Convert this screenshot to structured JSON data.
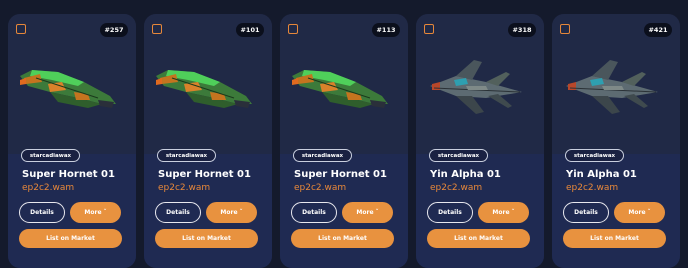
{
  "colors": {
    "accent": "#e8923f",
    "owner_text": "#e8883a",
    "card_bg": "#1c2440",
    "page_bg": "#141a2c"
  },
  "cards": [
    {
      "id_badge": "#257",
      "collection": "starcadiawax",
      "name": "Super Hornet 01",
      "owner": "ep2c2.wam",
      "details_label": "Details",
      "more_label": "More ˇ",
      "list_label": "List on Market",
      "ship_icon": "green-hornet-ship-icon"
    },
    {
      "id_badge": "#101",
      "collection": "starcadiawax",
      "name": "Super Hornet 01",
      "owner": "ep2c2.wam",
      "details_label": "Details",
      "more_label": "More ˇ",
      "list_label": "List on Market",
      "ship_icon": "green-hornet-ship-icon"
    },
    {
      "id_badge": "#113",
      "collection": "starcadiawax",
      "name": "Super Hornet 01",
      "owner": "ep2c2.wam",
      "details_label": "Details",
      "more_label": "More ˇ",
      "list_label": "List on Market",
      "ship_icon": "green-hornet-ship-icon"
    },
    {
      "id_badge": "#318",
      "collection": "starcadiawax",
      "name": "Yin Alpha 01",
      "owner": "ep2c2.wam",
      "details_label": "Details",
      "more_label": "More ˇ",
      "list_label": "List on Market",
      "ship_icon": "grey-alpha-ship-icon"
    },
    {
      "id_badge": "#421",
      "collection": "starcadiawax",
      "name": "Yin Alpha 01",
      "owner": "ep2c2.wam",
      "details_label": "Details",
      "more_label": "More ˇ",
      "list_label": "List on Market",
      "ship_icon": "grey-alpha-ship-icon"
    }
  ]
}
